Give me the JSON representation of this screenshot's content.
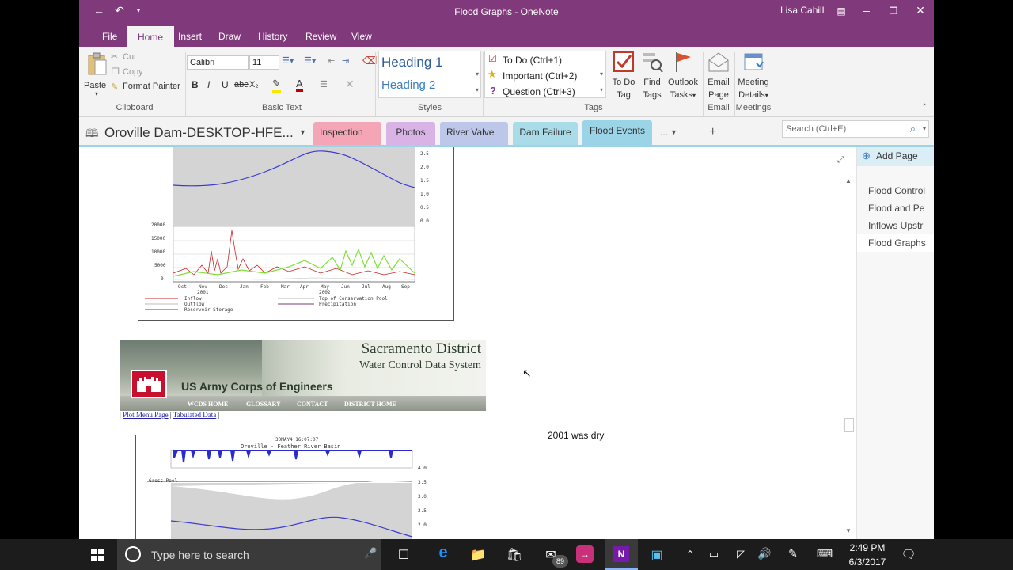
{
  "window": {
    "title": "Flood Graphs  -  OneNote",
    "user": "Lisa Cahill"
  },
  "ribbon_tabs": [
    "File",
    "Home",
    "Insert",
    "Draw",
    "History",
    "Review",
    "View"
  ],
  "clipboard": {
    "paste": "Paste",
    "cut": "Cut",
    "copy": "Copy",
    "format_painter": "Format Painter",
    "label": "Clipboard"
  },
  "basic_text": {
    "font": "Calibri",
    "size": "11",
    "label": "Basic Text",
    "bold": "B",
    "italic": "I",
    "underline": "U",
    "strike": "abc",
    "sub": "X₂"
  },
  "styles": {
    "h1": "Heading 1",
    "h2": "Heading 2",
    "label": "Styles"
  },
  "tags": {
    "todo": "To Do (Ctrl+1)",
    "important": "Important (Ctrl+2)",
    "question": "Question (Ctrl+3)",
    "label": "Tags",
    "todo_tag_1": "To Do",
    "todo_tag_2": "Tag",
    "find_1": "Find",
    "find_2": "Tags",
    "outlook_1": "Outlook",
    "outlook_2": "Tasks"
  },
  "email": {
    "l1": "Email",
    "l2": "Page",
    "label": "Email"
  },
  "meetings": {
    "l1": "Meeting",
    "l2": "Details",
    "label": "Meetings"
  },
  "notebook": {
    "name": "Oroville Dam-DESKTOP-HFE...",
    "sections": [
      "Inspection R...",
      "Photos",
      "River Valve ...",
      "Dam Failure",
      "Flood Events",
      "..."
    ],
    "add": "+",
    "search_placeholder": "Search (Ctrl+E)"
  },
  "pages": {
    "add": "Add Page",
    "items": [
      "Flood Control",
      "Flood and Pe",
      "Inflows Upstr",
      "Flood Graphs"
    ]
  },
  "content": {
    "note": "2001 was dry",
    "banner": {
      "title": "Sacramento District",
      "subtitle": "Water Control Data System",
      "org": "US Army Corps of Engineers",
      "nav": [
        "WCDS HOME",
        "GLOSSARY",
        "CONTACT",
        "DISTRICT HOME"
      ]
    },
    "links": {
      "plot_menu": "Plot Menu Page",
      "tabulated": "Tabulated Data"
    },
    "chart1": {
      "months": [
        "Oct",
        "Nov",
        "Dec",
        "Jan",
        "Feb",
        "Mar",
        "Apr",
        "May",
        "Jun",
        "Jul",
        "Aug",
        "Sep"
      ],
      "years": [
        "2001",
        "2002"
      ],
      "y_ticks": [
        "20000",
        "15000",
        "10000",
        "5000",
        "0"
      ],
      "right_ticks": [
        "2.5",
        "2.0",
        "1.5",
        "1.0",
        "0.5",
        "0.0"
      ],
      "legend": [
        "Inflow",
        "Outflow",
        "Reservoir Storage",
        "Top of Conservation Pool",
        "Precipitation"
      ]
    },
    "chart2": {
      "title": "Oroville - Feather River Basin",
      "stamp": "30MAY4 16:07:07",
      "gross": "Gross Pool",
      "right_ticks": [
        "4.0",
        "3.5",
        "3.0",
        "2.5",
        "2.0"
      ]
    }
  },
  "taskbar": {
    "search": "Type here to search",
    "time": "2:49 PM",
    "date": "6/3/2017",
    "badge": "89"
  }
}
